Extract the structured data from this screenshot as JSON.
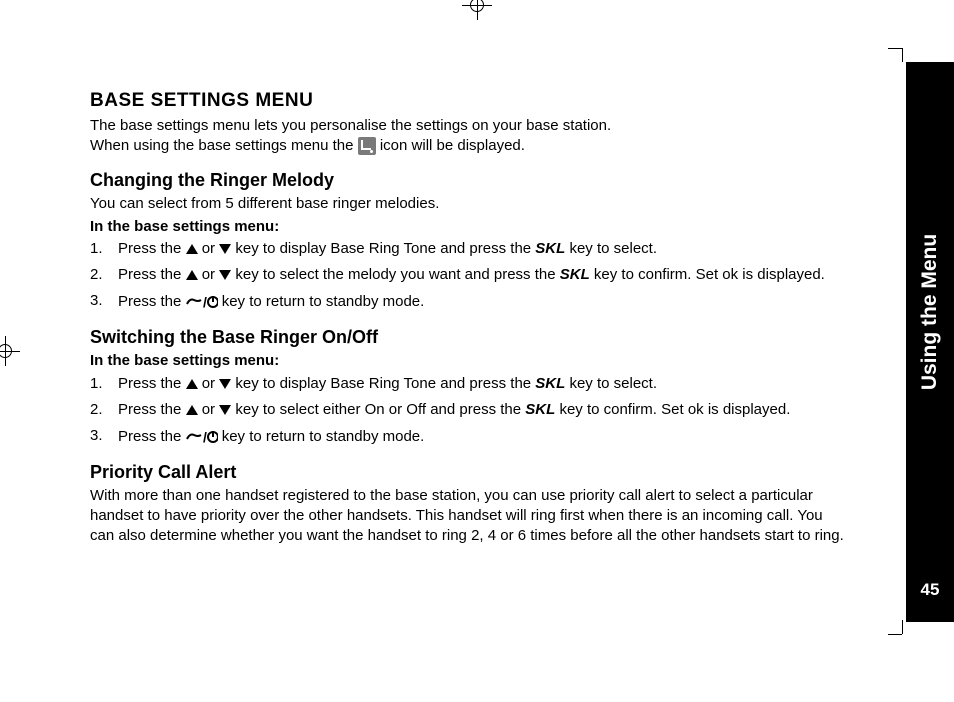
{
  "sidebar": {
    "label": "Using the Menu",
    "page_number": "45"
  },
  "section1": {
    "title": "BASE SETTINGS MENU",
    "intro_line1": "The base settings menu lets you personalise the settings on your base station.",
    "intro_line2a": "When using the base settings menu the ",
    "intro_line2b": " icon will be displayed."
  },
  "section2": {
    "title": "Changing the Ringer Melody",
    "intro": "You can select from 5 different base ringer melodies.",
    "sublabel": "In the base settings menu:",
    "step1a": "Press the ",
    "step1b": " or ",
    "step1c": " key to display Base Ring Tone and press the ",
    "step1d": " key to select.",
    "step2a": "Press the ",
    "step2b": " or ",
    "step2c": " key to select the melody you want and press the ",
    "step2d": " key to confirm. Set ok is displayed.",
    "step3a": "Press the ",
    "step3b": " key to return to standby mode.",
    "skl": "SKL"
  },
  "section3": {
    "title": "Switching the Base Ringer On/Off",
    "sublabel": "In the base settings menu:",
    "step1a": "Press the ",
    "step1b": " or ",
    "step1c": " key to display Base Ring Tone and press the ",
    "step1d": " key to select.",
    "step2a": "Press the ",
    "step2b": " or ",
    "step2c": " key to select either On or Off and press the ",
    "step2d": " key to confirm. Set ok is displayed.",
    "step3a": "Press the ",
    "step3b": " key to return to standby mode.",
    "skl": "SKL"
  },
  "section4": {
    "title": "Priority Call Alert",
    "body": "With more than one handset registered to the base station, you can use priority call alert to select a particular handset to have priority over the other handsets. This handset will ring first when there is an incoming call. You can also determine whether you want the handset to ring 2, 4 or 6 times before all the other handsets start to ring."
  }
}
